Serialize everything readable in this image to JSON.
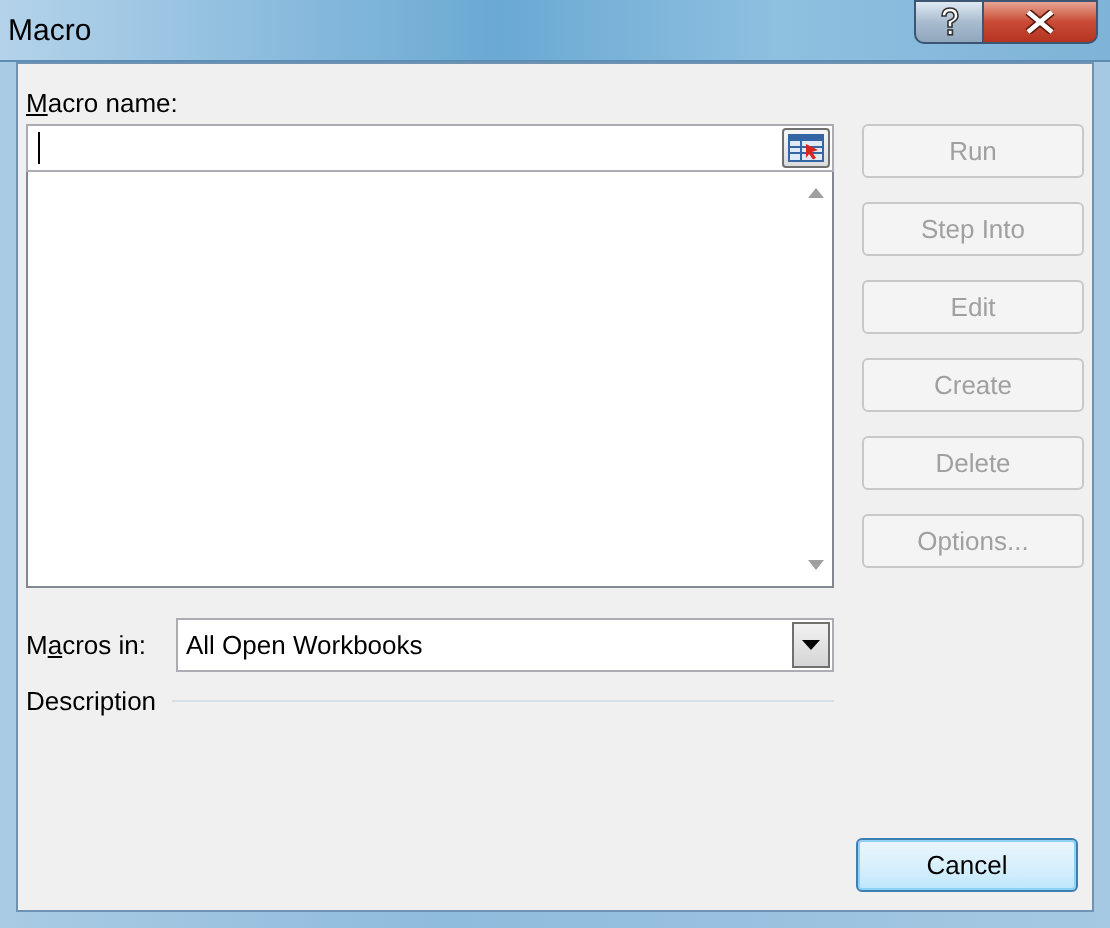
{
  "window": {
    "title": "Macro"
  },
  "macro_name": {
    "label": {
      "key": "M",
      "after": "acro name:"
    }
  },
  "buttons": [
    {
      "label": "Run",
      "disabled": true,
      "default": false
    },
    {
      "label": "Step Into",
      "disabled": true,
      "default": false
    },
    {
      "label": "Edit",
      "disabled": true,
      "default": false
    },
    {
      "label": "Create",
      "disabled": true,
      "default": false
    },
    {
      "label": "Delete",
      "disabled": true,
      "default": false
    },
    {
      "label": "Options...",
      "disabled": true,
      "default": false
    }
  ],
  "macros_in": {
    "label": {
      "before": "M",
      "key": "a",
      "after": "cros in:"
    },
    "value": "All Open Workbooks"
  },
  "description": {
    "label": "Description"
  },
  "cancel_button": {
    "label": "Cancel",
    "disabled": false,
    "default": true
  }
}
